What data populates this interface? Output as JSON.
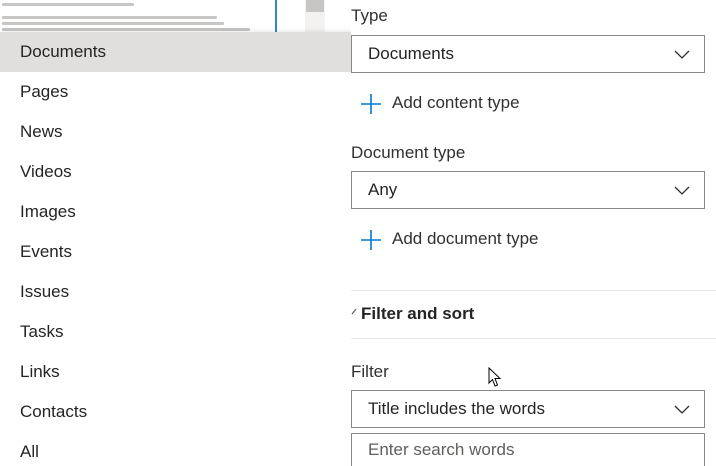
{
  "menu": {
    "items": [
      {
        "label": "Documents",
        "selected": true
      },
      {
        "label": "Pages"
      },
      {
        "label": "News"
      },
      {
        "label": "Videos"
      },
      {
        "label": "Images"
      },
      {
        "label": "Events"
      },
      {
        "label": "Issues"
      },
      {
        "label": "Tasks"
      },
      {
        "label": "Links"
      },
      {
        "label": "Contacts"
      },
      {
        "label": "All"
      }
    ]
  },
  "panel": {
    "type_label": "Type",
    "type_value": "Documents",
    "add_content_type": "Add content type",
    "document_type_label": "Document type",
    "document_type_value": "Any",
    "add_document_type": "Add document type",
    "filter_sort_title": "Filter and sort",
    "filter_label": "Filter",
    "filter_value": "Title includes the words",
    "search_placeholder": "Enter search words"
  },
  "icons": {
    "chevron": "chevron-down-icon",
    "add": "plus-icon",
    "collapse": "caret-icon",
    "cursor": "mouse-pointer-icon"
  },
  "colors": {
    "accent": "#0078d4",
    "selected_bg": "#e1dfdd",
    "border": "#8a8886"
  }
}
